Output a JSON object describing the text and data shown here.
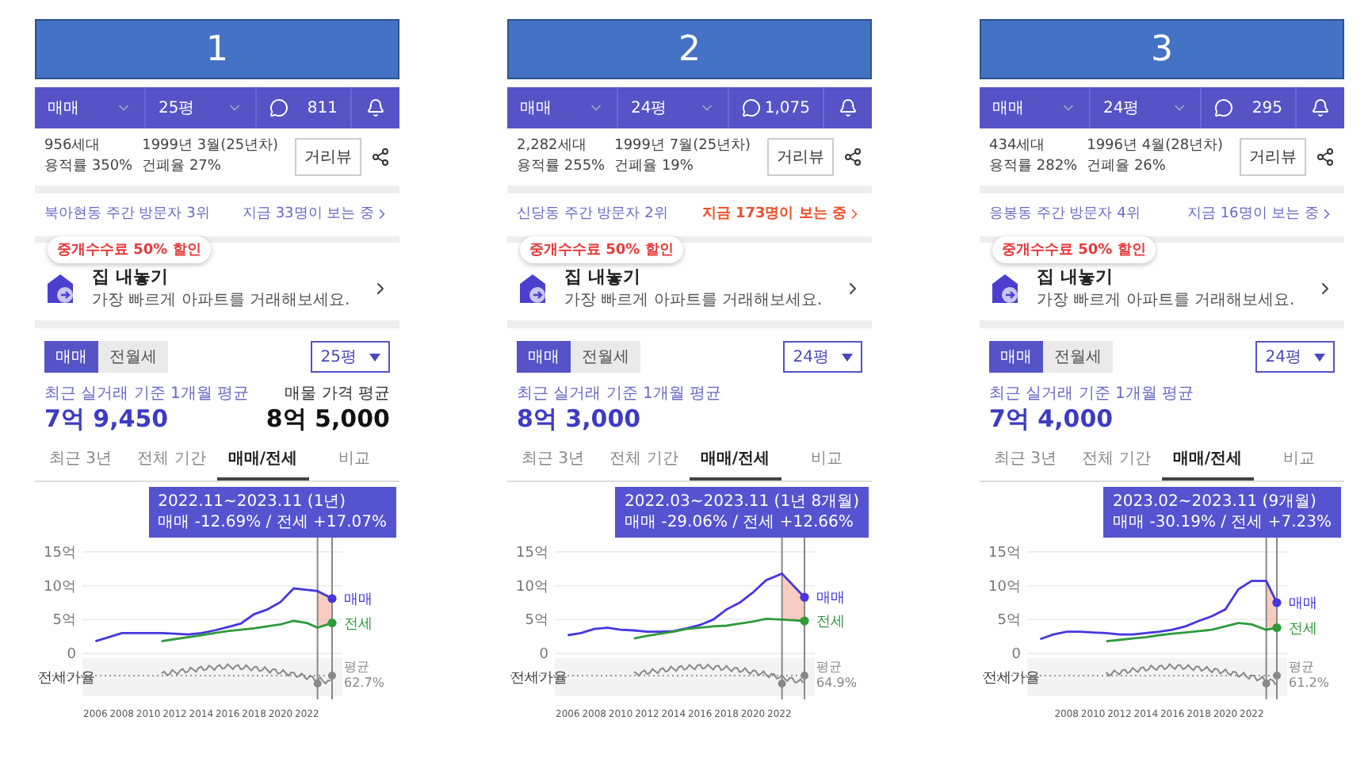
{
  "panels": [
    {
      "number": "1",
      "nav": {
        "trade_type": "매매",
        "size": "25평",
        "comments": "811"
      },
      "summary": {
        "households": "956세대",
        "built": "1999년 3월(25년차)",
        "floor_area_ratio": "용적률 350%",
        "coverage_ratio": "건폐율 27%",
        "street_view": "거리뷰"
      },
      "visitors": {
        "rank": "북아현동 주간 방문자 3위",
        "watching": "지금 33명이 보는 중",
        "hot": false
      },
      "promo": {
        "badge": "중개수수료 50% 할인",
        "title": "집 내놓기",
        "subtitle": "가장 빠르게 아파트를 거래해보세요."
      },
      "deal_toggle": [
        {
          "label": "매매",
          "selected": true
        },
        {
          "label": "전월세",
          "selected": false
        }
      ],
      "size_select": "25평",
      "average": {
        "label": "최근 실거래 기준 1개월 평균",
        "price": "7억 9,450"
      },
      "listing_average": {
        "label": "매물 가격 평균",
        "price": "8억 5,000"
      },
      "period_tabs": [
        {
          "label": "최근 3년",
          "selected": false
        },
        {
          "label": "전체 기간",
          "selected": false
        },
        {
          "label": "매매/전세",
          "selected": true
        },
        {
          "label": "비교",
          "selected": false
        }
      ],
      "tooltip": {
        "period": "2022.11~2023.11 (1년)",
        "change": "매매 -12.69%  /  전세 +17.07%"
      },
      "chart_data": {
        "type": "line",
        "x": [
          2006,
          2007,
          2008,
          2009,
          2010,
          2011,
          2012,
          2013,
          2014,
          2015,
          2016,
          2017,
          2018,
          2019,
          2020,
          2021,
          2022,
          2022.8,
          2023.9
        ],
        "series": [
          {
            "name": "매매",
            "color": "#4536e0",
            "values": [
              1.8,
              2.4,
              3,
              3,
              3,
              3,
              2.9,
              2.8,
              3,
              3.4,
              3.9,
              4.4,
              5.8,
              6.5,
              7.6,
              9.6,
              9.4,
              9.2,
              8.1
            ]
          },
          {
            "name": "전세",
            "color": "#2f9a3c",
            "values": [
              null,
              null,
              null,
              null,
              null,
              1.8,
              2.1,
              2.4,
              2.7,
              3,
              3.3,
              3.5,
              3.7,
              4,
              4.3,
              4.8,
              4.5,
              3.8,
              4.5
            ]
          }
        ],
        "ylim": [
          0,
          15
        ],
        "yticks": [
          {
            "value": 0,
            "label": "0"
          },
          {
            "value": 5,
            "label": "5억"
          },
          {
            "value": 10,
            "label": "10억"
          },
          {
            "value": 15,
            "label": "15억"
          }
        ],
        "xlim": [
          2005.5,
          2024.2
        ],
        "xticks": [
          2006,
          2008,
          2010,
          2012,
          2014,
          2016,
          2018,
          2020,
          2022
        ],
        "ref_lines": [
          {
            "axis": "x",
            "value": 2022.8
          },
          {
            "axis": "x",
            "value": 2023.9
          }
        ],
        "legend": "right"
      },
      "ratio": {
        "label": "전세가율",
        "average_label": "평균",
        "average": "62.7%"
      }
    },
    {
      "number": "2",
      "nav": {
        "trade_type": "매매",
        "size": "24평",
        "comments": "1,075"
      },
      "summary": {
        "households": "2,282세대",
        "built": "1999년 7월(25년차)",
        "floor_area_ratio": "용적률 255%",
        "coverage_ratio": "건폐율 19%",
        "street_view": "거리뷰"
      },
      "visitors": {
        "rank": "신당동 주간 방문자 2위",
        "watching": "지금 173명이 보는 중",
        "hot": true
      },
      "promo": {
        "badge": "중개수수료 50% 할인",
        "title": "집 내놓기",
        "subtitle": "가장 빠르게 아파트를 거래해보세요."
      },
      "deal_toggle": [
        {
          "label": "매매",
          "selected": true
        },
        {
          "label": "전월세",
          "selected": false
        }
      ],
      "size_select": "24평",
      "average": {
        "label": "최근 실거래 기준 1개월 평균",
        "price": "8억 3,000"
      },
      "period_tabs": [
        {
          "label": "최근 3년",
          "selected": false
        },
        {
          "label": "전체 기간",
          "selected": false
        },
        {
          "label": "매매/전세",
          "selected": true
        },
        {
          "label": "비교",
          "selected": false
        }
      ],
      "tooltip": {
        "period": "2022.03~2023.11 (1년 8개월)",
        "change": "매매 -29.06%  /  전세 +12.66%"
      },
      "chart_data": {
        "type": "line",
        "x": [
          2006,
          2007,
          2008,
          2009,
          2010,
          2011,
          2012,
          2013,
          2014,
          2015,
          2016,
          2017,
          2018,
          2019,
          2020,
          2021,
          2022.2,
          2023.9
        ],
        "series": [
          {
            "name": "매매",
            "color": "#4536e0",
            "values": [
              2.7,
              3,
              3.6,
              3.8,
              3.5,
              3.4,
              3.2,
              3.2,
              3.3,
              3.7,
              4.2,
              5,
              6.5,
              7.5,
              9,
              10.8,
              11.8,
              8.3
            ]
          },
          {
            "name": "전세",
            "color": "#2f9a3c",
            "values": [
              null,
              null,
              null,
              null,
              null,
              2.2,
              2.6,
              2.9,
              3.2,
              3.6,
              3.8,
              4,
              4.1,
              4.4,
              4.7,
              5.1,
              5,
              4.8
            ]
          }
        ],
        "ylim": [
          0,
          15
        ],
        "yticks": [
          {
            "value": 0,
            "label": "0"
          },
          {
            "value": 5,
            "label": "5억"
          },
          {
            "value": 10,
            "label": "10억"
          },
          {
            "value": 15,
            "label": "15억"
          }
        ],
        "xlim": [
          2005.5,
          2024.2
        ],
        "xticks": [
          2006,
          2008,
          2010,
          2012,
          2014,
          2016,
          2018,
          2020,
          2022
        ],
        "ref_lines": [
          {
            "axis": "x",
            "value": 2022.2
          },
          {
            "axis": "x",
            "value": 2023.9
          }
        ],
        "legend": "right"
      },
      "ratio": {
        "label": "전세가율",
        "average_label": "평균",
        "average": "64.9%"
      }
    },
    {
      "number": "3",
      "nav": {
        "trade_type": "매매",
        "size": "24평",
        "comments": "295"
      },
      "summary": {
        "households": "434세대",
        "built": "1996년 4월(28년차)",
        "floor_area_ratio": "용적률 282%",
        "coverage_ratio": "건폐율 26%",
        "street_view": "거리뷰"
      },
      "visitors": {
        "rank": "응봉동 주간 방문자 4위",
        "watching": "지금 16명이 보는 중",
        "hot": false
      },
      "promo": {
        "badge": "중개수수료 50% 할인",
        "title": "집 내놓기",
        "subtitle": "가장 빠르게 아파트를 거래해보세요."
      },
      "deal_toggle": [
        {
          "label": "매매",
          "selected": true
        },
        {
          "label": "전월세",
          "selected": false
        }
      ],
      "size_select": "24평",
      "average": {
        "label": "최근 실거래 기준 1개월 평균",
        "price": "7억 4,000"
      },
      "period_tabs": [
        {
          "label": "최근 3년",
          "selected": false
        },
        {
          "label": "전체 기간",
          "selected": false
        },
        {
          "label": "매매/전세",
          "selected": true
        },
        {
          "label": "비교",
          "selected": false
        }
      ],
      "tooltip": {
        "period": "2023.02~2023.11 (9개월)",
        "change": "매매 -30.19%  /  전세 +7.23%"
      },
      "chart_data": {
        "type": "line",
        "x": [
          2006,
          2007,
          2008,
          2009,
          2010,
          2011,
          2012,
          2013,
          2014,
          2015,
          2016,
          2017,
          2018,
          2019,
          2020,
          2021,
          2022,
          2023.1,
          2023.9
        ],
        "series": [
          {
            "name": "매매",
            "color": "#4536e0",
            "values": [
              2.1,
              2.8,
              3.2,
              3.2,
              3.1,
              3,
              2.8,
              2.8,
              3,
              3.2,
              3.5,
              4,
              4.8,
              5.5,
              6.5,
              9.5,
              10.7,
              10.7,
              7.5
            ]
          },
          {
            "name": "전세",
            "color": "#2f9a3c",
            "values": [
              null,
              null,
              null,
              null,
              null,
              1.8,
              2,
              2.2,
              2.4,
              2.7,
              2.9,
              3.1,
              3.3,
              3.5,
              4,
              4.5,
              4.3,
              3.5,
              3.8
            ]
          }
        ],
        "ylim": [
          0,
          15
        ],
        "yticks": [
          {
            "value": 0,
            "label": "0"
          },
          {
            "value": 5,
            "label": "5억"
          },
          {
            "value": 10,
            "label": "10억"
          },
          {
            "value": 15,
            "label": "15억"
          }
        ],
        "xlim": [
          2005.5,
          2024.2
        ],
        "xticks": [
          2008,
          2010,
          2012,
          2014,
          2016,
          2018,
          2020,
          2022
        ],
        "ref_lines": [
          {
            "axis": "x",
            "value": 2023.1
          },
          {
            "axis": "x",
            "value": 2023.9
          }
        ],
        "legend": "right"
      },
      "ratio": {
        "label": "전세가율",
        "average_label": "평균",
        "average": "61.2%"
      }
    }
  ]
}
